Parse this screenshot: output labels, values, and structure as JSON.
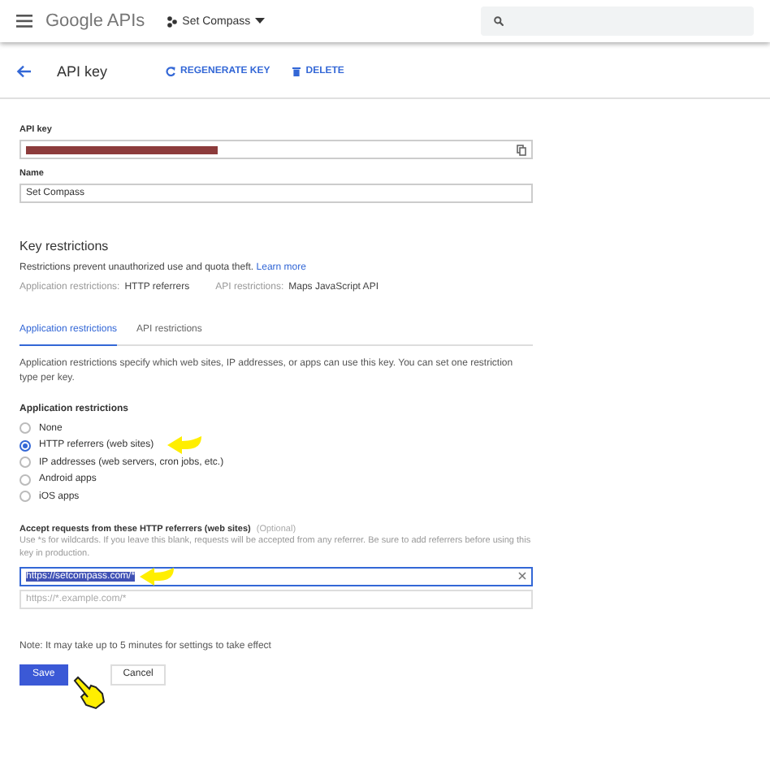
{
  "header": {
    "logo": "Google APIs",
    "project": "Set Compass"
  },
  "toolbar": {
    "title": "API key",
    "actions": [
      {
        "kind": "regenerate",
        "label": "REGENERATE KEY"
      },
      {
        "kind": "delete",
        "label": "DELETE"
      }
    ]
  },
  "fields": [
    {
      "label": "API key",
      "kind": "redacted"
    },
    {
      "label": "Name",
      "kind": "text",
      "value": "Set Compass"
    }
  ],
  "restrictions": {
    "title": "Key restrictions",
    "text": "Restrictions prevent unauthorized use and quota theft.",
    "link": "Learn more",
    "summary": [
      {
        "label": "Application restrictions:",
        "value": "HTTP referrers"
      },
      {
        "label": "API restrictions:",
        "value": "Maps JavaScript API"
      }
    ]
  },
  "tabs": [
    {
      "label": "Application restrictions",
      "selected": true
    },
    {
      "label": "API restrictions",
      "selected": false
    }
  ],
  "description": "Application restrictions specify which web sites, IP addresses, or apps can use this key. You can set one restriction type per key.",
  "radio_group": {
    "title": "Application restrictions",
    "options": [
      {
        "label": "None",
        "selected": false
      },
      {
        "label": "HTTP referrers (web sites)",
        "selected": true
      },
      {
        "label": "IP addresses (web servers, cron jobs, etc.)",
        "selected": false
      },
      {
        "label": "Android apps",
        "selected": false
      },
      {
        "label": "iOS apps",
        "selected": false
      }
    ]
  },
  "referrers": {
    "label": "Accept requests from these HTTP referrers (web sites)",
    "optional": "(Optional)",
    "help": "Use *s for wildcards. If you leave this blank, requests will be accepted from any referrer. Be sure to add referrers before using this key in production.",
    "entries": [
      {
        "value": "https://setcompass.com/*",
        "highlighted": true
      }
    ],
    "placeholder": "https://*.example.com/*"
  },
  "note": "Note: It may take up to 5 minutes for settings to take effect",
  "buttons": [
    {
      "label": "Save",
      "kind": "primary"
    },
    {
      "label": "Cancel",
      "kind": "secondary"
    }
  ]
}
